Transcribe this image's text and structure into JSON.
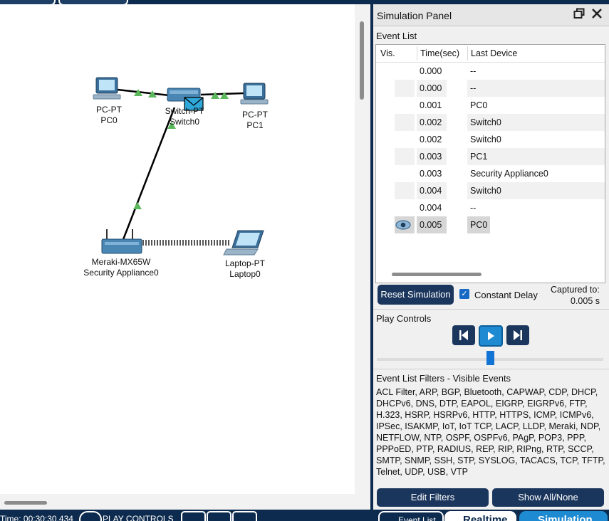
{
  "workspace": {
    "devices": [
      {
        "type_label": "PC-PT",
        "name": "PC0"
      },
      {
        "type_label": "Switch-PT",
        "name": "Switch0"
      },
      {
        "type_label": "PC-PT",
        "name": "PC1"
      },
      {
        "type_label": "Meraki-MX65W",
        "name": "Security Appliance0"
      },
      {
        "type_label": "Laptop-PT",
        "name": "Laptop0"
      }
    ]
  },
  "sim_panel": {
    "title": "Simulation Panel",
    "event_list_label": "Event List",
    "columns": [
      "Vis.",
      "Time(sec)",
      "Last Device"
    ],
    "events": [
      {
        "time": "0.000",
        "device": "--"
      },
      {
        "time": "0.000",
        "device": "--"
      },
      {
        "time": "0.001",
        "device": "PC0"
      },
      {
        "time": "0.002",
        "device": "Switch0"
      },
      {
        "time": "0.002",
        "device": "Switch0"
      },
      {
        "time": "0.003",
        "device": "PC1"
      },
      {
        "time": "0.003",
        "device": "Security Appliance0"
      },
      {
        "time": "0.004",
        "device": "Switch0"
      },
      {
        "time": "0.004",
        "device": "--"
      },
      {
        "time": "0.005",
        "device": "PC0"
      }
    ],
    "reset_label": "Reset Simulation",
    "constant_delay_label": "Constant Delay",
    "constant_delay_checked": true,
    "captured_to_label": "Captured to:",
    "captured_to_value": "0.005 s",
    "play_controls_label": "Play Controls",
    "filters_title": "Event List Filters - Visible Events",
    "filters_text": "ACL Filter, ARP, BGP, Bluetooth, CAPWAP, CDP, DHCP, DHCPv6, DNS, DTP, EAPOL, EIGRP, EIGRPv6, FTP, H.323, HSRP, HSRPv6, HTTP, HTTPS, ICMP, ICMPv6, IPSec, ISAKMP, IoT, IoT TCP, LACP, LLDP, Meraki, NDP, NETFLOW, NTP, OSPF, OSPFv6, PAgP, POP3, PPP, PPPoED, PTP, RADIUS, REP, RIP, RIPng, RTP, SCCP, SMTP, SNMP, SSH, STP, SYSLOG, TACACS, TCP, TFTP, Telnet, UDP, USB, VTP",
    "edit_filters_label": "Edit Filters",
    "show_all_label": "Show All/None"
  },
  "bottom_bar": {
    "time_text": "Time: 00:30:30.434",
    "play_controls_text": "PLAY CONTROLS",
    "event_list_btn": "Event List",
    "realtime_btn": "Realtime",
    "simulation_btn": "Simulation"
  },
  "colors": {
    "frame": "#0d2b4e",
    "button_dark": "#1b365d",
    "accent_blue": "#1e8ad2",
    "link_green": "#5cb85c"
  }
}
